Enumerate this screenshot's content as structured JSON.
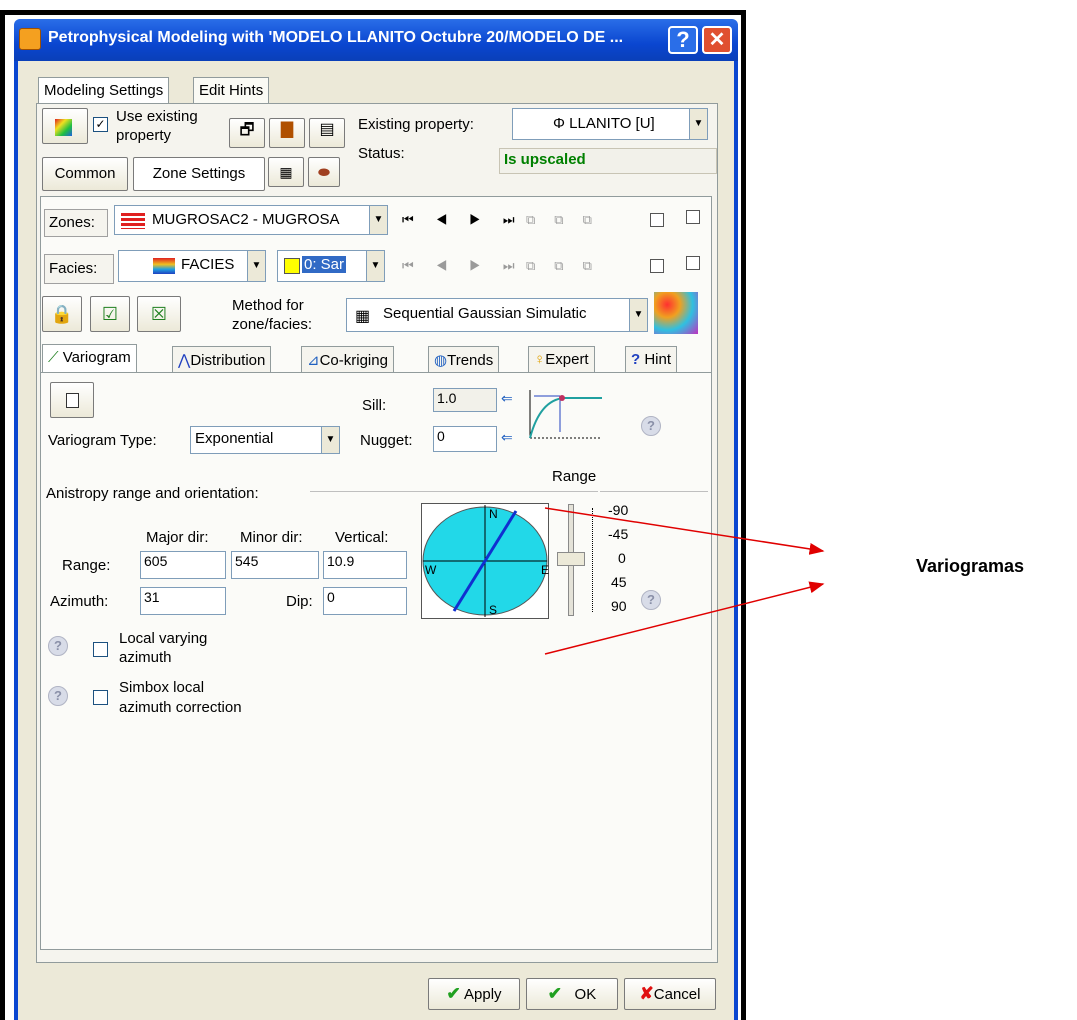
{
  "window": {
    "title": "Petrophysical Modeling with 'MODELO LLANITO Octubre 20/MODELO DE ...",
    "help_glyph": "?",
    "close_glyph": "✕"
  },
  "tabs": {
    "modeling_settings": "Modeling Settings",
    "edit_hints": "Edit Hints"
  },
  "top": {
    "use_existing_label_1": "Use existing",
    "use_existing_label_2": "property",
    "use_existing_checked": "✓",
    "existing_property_label": "Existing property:",
    "existing_property_value": "Φ LLANITO [U]",
    "status_label": "Status:",
    "status_value": "Is upscaled"
  },
  "subtabs": {
    "common": "Common",
    "zone_settings": "Zone Settings"
  },
  "zones": {
    "label": "Zones:",
    "value": "MUGROSAC2 - MUGROSA"
  },
  "facies": {
    "label": "Facies:",
    "value": "FACIES",
    "code": "0: Sar"
  },
  "method": {
    "label_1": "Method for",
    "label_2": "zone/facies:",
    "value": "Sequential Gaussian Simulatic"
  },
  "method_tabs": [
    "Variogram",
    "Distribution",
    "Co-kriging",
    "Trends",
    "Expert",
    "Hint"
  ],
  "variogram": {
    "sill_label": "Sill:",
    "sill_value": "1.0",
    "type_label": "Variogram Type:",
    "type_value": "Exponential",
    "nugget_label": "Nugget:",
    "nugget_value": "0",
    "range_header": "Range",
    "anisotropy_label": "Anistropy range and orientation:",
    "major_label": "Major dir:",
    "minor_label": "Minor dir:",
    "vertical_label": "Vertical:",
    "range_label": "Range:",
    "major_value": "605",
    "minor_value": "545",
    "vertical_value": "10.9",
    "azimuth_label": "Azimuth:",
    "azimuth_value": "31",
    "dip_label": "Dip:",
    "dip_value": "0",
    "compass": {
      "n": "N",
      "s": "S",
      "e": "E",
      "w": "W"
    },
    "scale": [
      "-90",
      "-45",
      "0",
      "45",
      "90"
    ],
    "local_varying_1": "Local varying",
    "local_varying_2": "azimuth",
    "simbox_1": "Simbox local",
    "simbox_2": "azimuth correction"
  },
  "buttons": {
    "apply": "Apply",
    "ok": "OK",
    "cancel": "Cancel"
  },
  "annotation": {
    "label": "Variogramas"
  },
  "colors": {
    "title_bar": "#0a46d0",
    "status_green": "#008000",
    "arrow_red": "#e00000",
    "compass_fill": "#22d8e8"
  }
}
